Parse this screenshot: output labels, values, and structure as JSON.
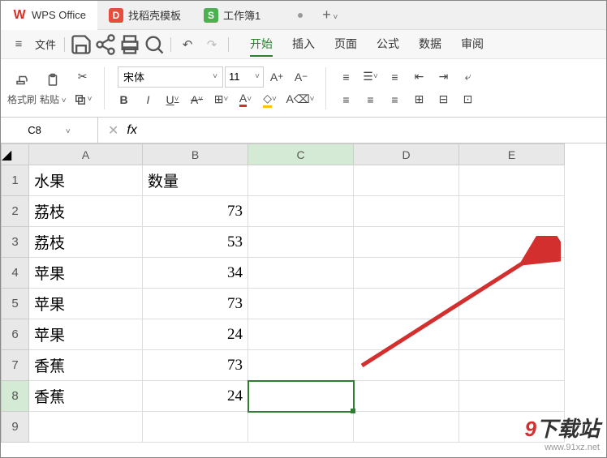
{
  "tabs": {
    "wps": "WPS Office",
    "docer": "找稻壳模板",
    "sheet": "工作簿1"
  },
  "menu": {
    "file": "文件"
  },
  "ribbon": {
    "start": "开始",
    "insert": "插入",
    "page": "页面",
    "formula": "公式",
    "data": "数据",
    "review": "审阅"
  },
  "toolbar": {
    "brush": "格式刷",
    "paste": "粘贴",
    "font_name": "宋体",
    "font_size": "11",
    "bold": "B",
    "italic": "I",
    "underline": "U",
    "strike": "A"
  },
  "namebox": {
    "cell": "C8",
    "fx": "fx"
  },
  "columns": [
    "A",
    "B",
    "C",
    "D",
    "E"
  ],
  "rows": [
    {
      "n": "1",
      "a": "水果",
      "b": "数量"
    },
    {
      "n": "2",
      "a": "荔枝",
      "b": "73"
    },
    {
      "n": "3",
      "a": "荔枝",
      "b": "53"
    },
    {
      "n": "4",
      "a": "苹果",
      "b": "34"
    },
    {
      "n": "5",
      "a": "苹果",
      "b": "73"
    },
    {
      "n": "6",
      "a": "苹果",
      "b": "24"
    },
    {
      "n": "7",
      "a": "香蕉",
      "b": "73"
    },
    {
      "n": "8",
      "a": "香蕉",
      "b": "24"
    },
    {
      "n": "9",
      "a": "",
      "b": ""
    }
  ],
  "watermark": {
    "brand": "9",
    "brand2": "下载站",
    "url": "www.91xz.net"
  }
}
